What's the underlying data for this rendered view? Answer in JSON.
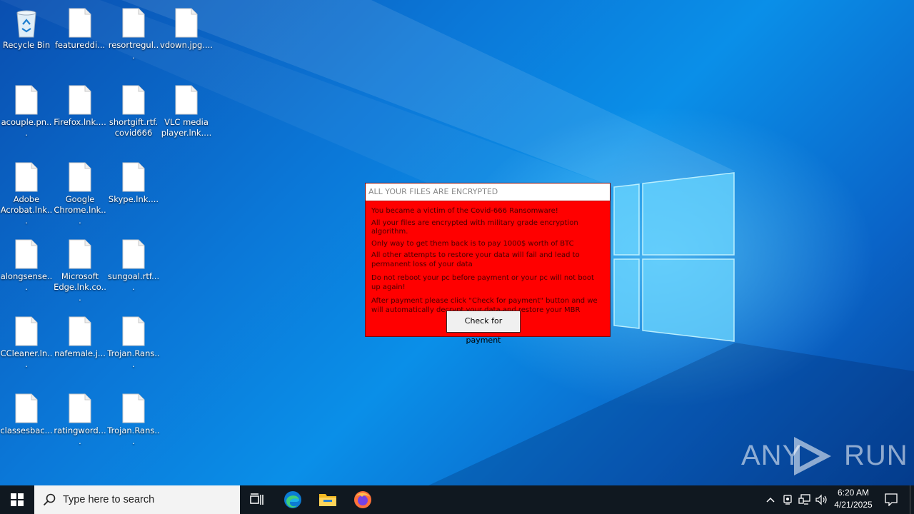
{
  "desktop": {
    "icons": [
      {
        "label": "Recycle Bin",
        "icon": "recycle-bin-icon"
      },
      {
        "label": "featureddi...",
        "icon": "file-icon"
      },
      {
        "label": "resortregul...",
        "icon": "file-icon"
      },
      {
        "label": "vdown.jpg....",
        "icon": "file-icon"
      },
      {
        "label": "acouple.pn...",
        "icon": "file-icon"
      },
      {
        "label": "Firefox.lnk....",
        "icon": "file-icon"
      },
      {
        "label": "shortgift.rtf.covid666",
        "icon": "file-icon"
      },
      {
        "label": "VLC media player.lnk....",
        "icon": "file-icon"
      },
      {
        "label": "Adobe Acrobat.lnk...",
        "icon": "file-icon"
      },
      {
        "label": "Google Chrome.lnk...",
        "icon": "file-icon"
      },
      {
        "label": "Skype.lnk....",
        "icon": "file-icon"
      },
      {
        "label": "alongsense...",
        "icon": "file-icon"
      },
      {
        "label": "Microsoft Edge.lnk.co...",
        "icon": "file-icon"
      },
      {
        "label": "sungoal.rtf....",
        "icon": "file-icon"
      },
      {
        "label": "CCleaner.ln...",
        "icon": "file-icon"
      },
      {
        "label": "nafemale.j...",
        "icon": "file-icon"
      },
      {
        "label": "Trojan.Rans...",
        "icon": "file-icon"
      },
      {
        "label": "classesbac...",
        "icon": "file-icon"
      },
      {
        "label": "ratingword....",
        "icon": "file-icon"
      },
      {
        "label": "Trojan.Rans...",
        "icon": "file-icon"
      }
    ]
  },
  "ransom_window": {
    "title": "ALL YOUR FILES ARE ENCRYPTED",
    "lines": [
      "You became a victim of the Covid-666 Ransomware!",
      "All your files are encrypted with military grade encryption algorithm.",
      "Only way to get them back is to pay 1000$ worth of BTC",
      "All other attempts to restore your data will fail and lead to permanent loss of your data",
      "Do not reboot your pc before payment or your pc will not boot up again!",
      "After payment please click \"Check for payment\" button and we will automatically decrypt your data and restore your MBR"
    ],
    "button_label": "Check for payment",
    "bg_color": "#ff0000"
  },
  "watermark": {
    "left": "ANY",
    "right": "RUN"
  },
  "taskbar": {
    "search_placeholder": "Type here to search",
    "time": "6:20 AM",
    "date": "4/21/2025",
    "pinned": [
      "task-view-icon",
      "edge-icon",
      "file-explorer-icon",
      "firefox-icon"
    ]
  }
}
